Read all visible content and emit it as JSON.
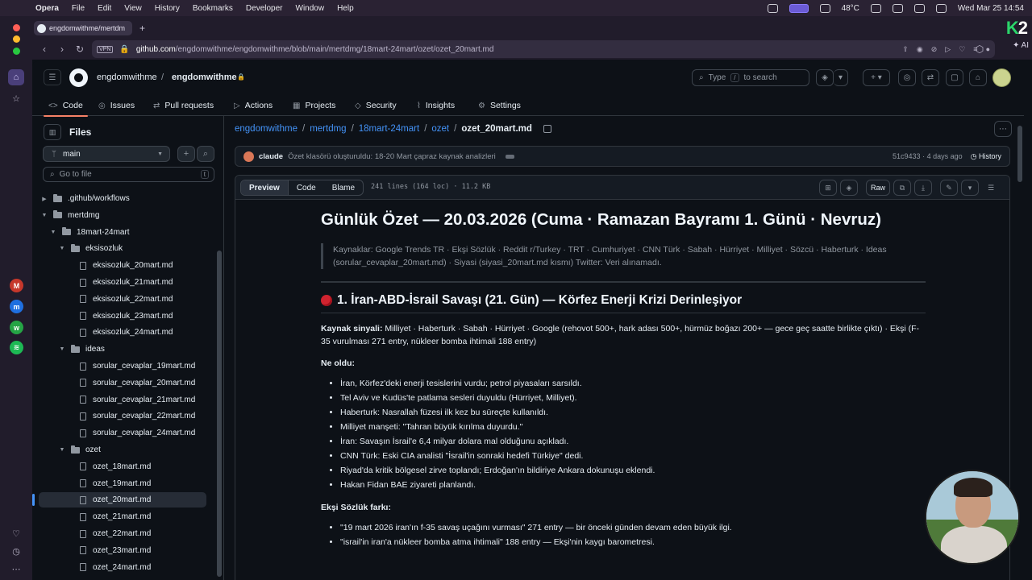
{
  "menubar": {
    "app": "Opera",
    "items": [
      "File",
      "Edit",
      "View",
      "History",
      "Bookmarks",
      "Developer",
      "Window",
      "Help"
    ],
    "temperature": "48°C",
    "clock": "Wed Mar 25  14:54"
  },
  "browser": {
    "tab_title": "engdomwithme/mertdm",
    "url_host": "github.com",
    "url_path": "/engdomwithme/engdomwithme/blob/main/mertdmg/18mart-24mart/ozet/ozet_20mart.md",
    "vpn_label": "VPN",
    "ai_label": "AI",
    "logo_k": "K",
    "logo_2": "2"
  },
  "header": {
    "owner": "engdomwithme",
    "repo": "engdomwithme",
    "search_placeholder": "Type",
    "search_key": "/",
    "search_suffix": "to search"
  },
  "tabs": [
    {
      "icon": "<>",
      "label": "Code"
    },
    {
      "icon": "◎",
      "label": "Issues"
    },
    {
      "icon": "⇄",
      "label": "Pull requests"
    },
    {
      "icon": "▷",
      "label": "Actions"
    },
    {
      "icon": "▦",
      "label": "Projects"
    },
    {
      "icon": "◇",
      "label": "Security"
    },
    {
      "icon": "⌇",
      "label": "Insights"
    },
    {
      "icon": "⚙",
      "label": "Settings"
    }
  ],
  "filetree": {
    "title": "Files",
    "branch": "main",
    "goto_placeholder": "Go to file",
    "goto_key": "t",
    "rows": [
      {
        "label": ".github/workflows",
        "type": "folder",
        "depth": 0,
        "expanded": false
      },
      {
        "label": "mertdmg",
        "type": "folder",
        "depth": 0,
        "expanded": true
      },
      {
        "label": "18mart-24mart",
        "type": "folder",
        "depth": 1,
        "expanded": true
      },
      {
        "label": "eksisozluk",
        "type": "folder",
        "depth": 2,
        "expanded": true
      },
      {
        "label": "eksisozluk_20mart.md",
        "type": "file",
        "depth": 3
      },
      {
        "label": "eksisozluk_21mart.md",
        "type": "file",
        "depth": 3
      },
      {
        "label": "eksisozluk_22mart.md",
        "type": "file",
        "depth": 3
      },
      {
        "label": "eksisozluk_23mart.md",
        "type": "file",
        "depth": 3
      },
      {
        "label": "eksisozluk_24mart.md",
        "type": "file",
        "depth": 3
      },
      {
        "label": "ideas",
        "type": "folder",
        "depth": 2,
        "expanded": true
      },
      {
        "label": "sorular_cevaplar_19mart.md",
        "type": "file",
        "depth": 3
      },
      {
        "label": "sorular_cevaplar_20mart.md",
        "type": "file",
        "depth": 3
      },
      {
        "label": "sorular_cevaplar_21mart.md",
        "type": "file",
        "depth": 3
      },
      {
        "label": "sorular_cevaplar_22mart.md",
        "type": "file",
        "depth": 3
      },
      {
        "label": "sorular_cevaplar_24mart.md",
        "type": "file",
        "depth": 3
      },
      {
        "label": "ozet",
        "type": "folder",
        "depth": 2,
        "expanded": true
      },
      {
        "label": "ozet_18mart.md",
        "type": "file",
        "depth": 3
      },
      {
        "label": "ozet_19mart.md",
        "type": "file",
        "depth": 3
      },
      {
        "label": "ozet_20mart.md",
        "type": "file",
        "depth": 3,
        "selected": true
      },
      {
        "label": "ozet_21mart.md",
        "type": "file",
        "depth": 3
      },
      {
        "label": "ozet_22mart.md",
        "type": "file",
        "depth": 3
      },
      {
        "label": "ozet_23mart.md",
        "type": "file",
        "depth": 3
      },
      {
        "label": "ozet_24mart.md",
        "type": "file",
        "depth": 3
      }
    ]
  },
  "path": {
    "segments": [
      "engdomwithme",
      "mertdmg",
      "18mart-24mart",
      "ozet"
    ],
    "current": "ozet_20mart.md"
  },
  "commit": {
    "author": "claude",
    "message": "Özet klasörü oluşturuldu: 18-20 Mart çapraz kaynak analizleri",
    "sha": "51c9433",
    "age": "· 4 days ago",
    "history_label": "History"
  },
  "fileview": {
    "modes": [
      "Preview",
      "Code",
      "Blame"
    ],
    "meta": "241 lines (164 loc) · 11.2 KB",
    "raw_label": "Raw"
  },
  "document": {
    "title": "Günlük Özet — 20.03.2026 (Cuma · Ramazan Bayramı 1. Günü · Nevruz)",
    "sources": "Kaynaklar: Google Trends TR · Ekşi Sözlük · Reddit r/Turkey · TRT · Cumhuriyet · CNN Türk · Sabah · Hürriyet · Milliyet · Sözcü · Haberturk · Ideas (sorular_cevaplar_20mart.md) · Siyasi (siyasi_20mart.md kısmı) Twitter: Veri alınamadı.",
    "section_title": "1. İran-ABD-İsrail Savaşı (21. Gün) — Körfez Enerji Krizi Derinleşiyor",
    "signal_label": "Kaynak sinyali:",
    "signal_text": " Milliyet · Haberturk · Sabah · Hürriyet · Google (rehovot 500+, hark adası 500+, hürmüz boğazı 200+ — gece geç saatte birlikte çıktı) · Ekşi (F-35 vurulması 271 entry, nükleer bomba ihtimali 188 entry)",
    "what_label": "Ne oldu:",
    "what_items": [
      "İran, Körfez'deki enerji tesislerini vurdu; petrol piyasaları sarsıldı.",
      "Tel Aviv ve Kudüs'te patlama sesleri duyuldu (Hürriyet, Milliyet).",
      "Haberturk: Nasrallah füzesi ilk kez bu süreçte kullanıldı.",
      "Milliyet manşeti: \"Tahran büyük kırılma duyurdu.\"",
      "İran: Savaşın İsrail'e 6,4 milyar dolara mal olduğunu açıkladı.",
      "CNN Türk: Eski CIA analisti \"İsrail'in sonraki hedefi Türkiye\" dedi.",
      "Riyad'da kritik bölgesel zirve toplandı; Erdoğan'ın bildiriye Ankara dokunuşu eklendi.",
      "Hakan Fidan BAE ziyareti planlandı."
    ],
    "eksi_label": "Ekşi Sözlük farkı:",
    "eksi_items": [
      "\"19 mart 2026 iran'ın f-35 savaş uçağını vurması\" 271 entry — bir önceki günden devam eden büyük ilgi.",
      "\"israil'in iran'a nükleer bomba atma ihtimali\" 188 entry — Ekşi'nin kaygı barometresi."
    ]
  }
}
